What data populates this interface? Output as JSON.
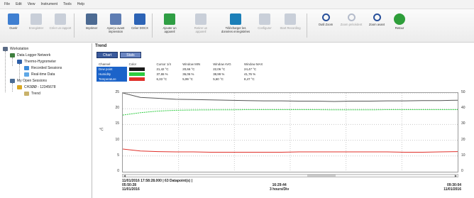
{
  "menu": [
    "File",
    "Edit",
    "View",
    "Instrument",
    "Tools",
    "Help"
  ],
  "toolbar": [
    {
      "label": "Ouvrir",
      "icon": "folder-open-icon",
      "disabled": false
    },
    {
      "label": "Enregistrer",
      "icon": "save-icon",
      "disabled": true
    },
    {
      "label": "Créer un rapport",
      "icon": "report-icon",
      "disabled": true
    },
    {
      "label": "Imprimer",
      "icon": "print-icon",
      "disabled": false
    },
    {
      "label": "Aperçu avant impression",
      "icon": "print-preview-icon",
      "disabled": false
    },
    {
      "label": "Créer DOCX",
      "icon": "docx-icon",
      "disabled": false
    },
    {
      "label": "Ajouter un appareil",
      "icon": "add-device-icon",
      "disabled": false
    },
    {
      "label": "Retirer un appareil",
      "icon": "remove-device-icon",
      "disabled": true
    },
    {
      "label": "Télécharger les données enregistrées",
      "icon": "download-icon",
      "disabled": false
    },
    {
      "label": "Configurer",
      "icon": "configure-icon",
      "disabled": true
    },
    {
      "label": "Start Recording",
      "icon": "record-icon",
      "disabled": true
    },
    {
      "label": "Outil Zoom",
      "icon": "zoom-tool-icon",
      "disabled": false
    },
    {
      "label": "Zoom précédent",
      "icon": "zoom-previous-icon",
      "disabled": true
    },
    {
      "label": "Zoom avant",
      "icon": "zoom-in-icon",
      "disabled": false
    },
    {
      "label": "Retour",
      "icon": "back-icon",
      "disabled": false
    }
  ],
  "tree": [
    {
      "label": "Workstation",
      "level": 0,
      "icon": "workstation-icon"
    },
    {
      "label": "Data Logger Network",
      "level": 1,
      "icon": "network-icon"
    },
    {
      "label": "Thermo-Hygrometer",
      "level": 2,
      "icon": "device-icon"
    },
    {
      "label": "Recorded Sessions",
      "level": 3,
      "icon": "sessions-icon"
    },
    {
      "label": "Real-time Data",
      "level": 3,
      "icon": "realtime-icon"
    },
    {
      "label": "My Open Sessions",
      "level": 1,
      "icon": "open-sessions-icon"
    },
    {
      "label": "CH2ØØ - 12345678",
      "level": 2,
      "icon": "session-folder-icon"
    },
    {
      "label": "Trend",
      "level": 3,
      "icon": "trend-icon"
    }
  ],
  "panel": {
    "title": "Trend",
    "tabs": [
      "Chart",
      "Stats"
    ],
    "table_headers": [
      "Channel",
      "Color",
      "Cursor 1/4",
      "Window MIN",
      "Window AVG",
      "Window MAX"
    ],
    "channels": [
      {
        "name": "Dew point",
        "color": "#1a1a1a",
        "cursor": "21,42 °C",
        "min": "20,66 °C",
        "avg": "22,06 °C",
        "max": "24,47 °C"
      },
      {
        "name": "Humidity",
        "color": "#2ecc40",
        "cursor": "37,65 %",
        "min": "36,06 %",
        "avg": "38,99 %",
        "max": "41,76 %"
      },
      {
        "name": "Temperature",
        "color": "#e0302a",
        "cursor": "6,33 °C",
        "min": "5,99 °C",
        "avg": "5,60 °C",
        "max": "8,47 °C"
      }
    ]
  },
  "chart_data": {
    "type": "line",
    "ylabel": "°C",
    "y_left_ticks": [
      0,
      5,
      10,
      15,
      20,
      25
    ],
    "y_right_ticks": [
      0,
      10,
      20,
      30,
      40,
      50
    ],
    "ylim_left": [
      0,
      25
    ],
    "ylim_right": [
      0,
      50
    ],
    "grid": true,
    "series": [
      {
        "name": "Dew point",
        "color": "#555555",
        "axis": "left",
        "values": [
          25.0,
          23.6,
          23.3,
          23.0,
          22.9,
          22.8,
          22.7,
          22.6,
          22.5,
          22.5,
          22.4,
          22.4,
          22.3,
          22.4,
          22.4,
          22.5,
          22.5,
          22.6,
          22.6,
          22.7
        ]
      },
      {
        "name": "Humidity",
        "color": "#2ecc40",
        "axis": "right",
        "values": [
          36.0,
          37.5,
          38.5,
          39.0,
          39.2,
          39.3,
          39.3,
          39.4,
          39.4,
          39.4,
          39.4,
          39.4,
          39.3,
          39.3,
          39.3,
          39.4,
          39.4,
          39.4,
          39.4,
          39.4
        ]
      },
      {
        "name": "Temperature",
        "color": "#e0302a",
        "axis": "left",
        "values": [
          7.2,
          6.6,
          6.4,
          6.3,
          6.3,
          6.2,
          6.2,
          6.2,
          6.2,
          6.2,
          6.3,
          6.3,
          6.3,
          6.3,
          6.3,
          6.3,
          6.2,
          6.2,
          6.3,
          6.4
        ]
      }
    ]
  },
  "footer": {
    "left_line1": "11/01/2016 17:58:28.000 | 63 Datapoint(s) |",
    "left_line2": "05:50:28",
    "left_line3": "11/01/2016",
    "center_line1": "16:29:44",
    "center_line2": "3 hours/Div",
    "right_line1": "09:30:04",
    "right_line2": "11/01/2016"
  }
}
